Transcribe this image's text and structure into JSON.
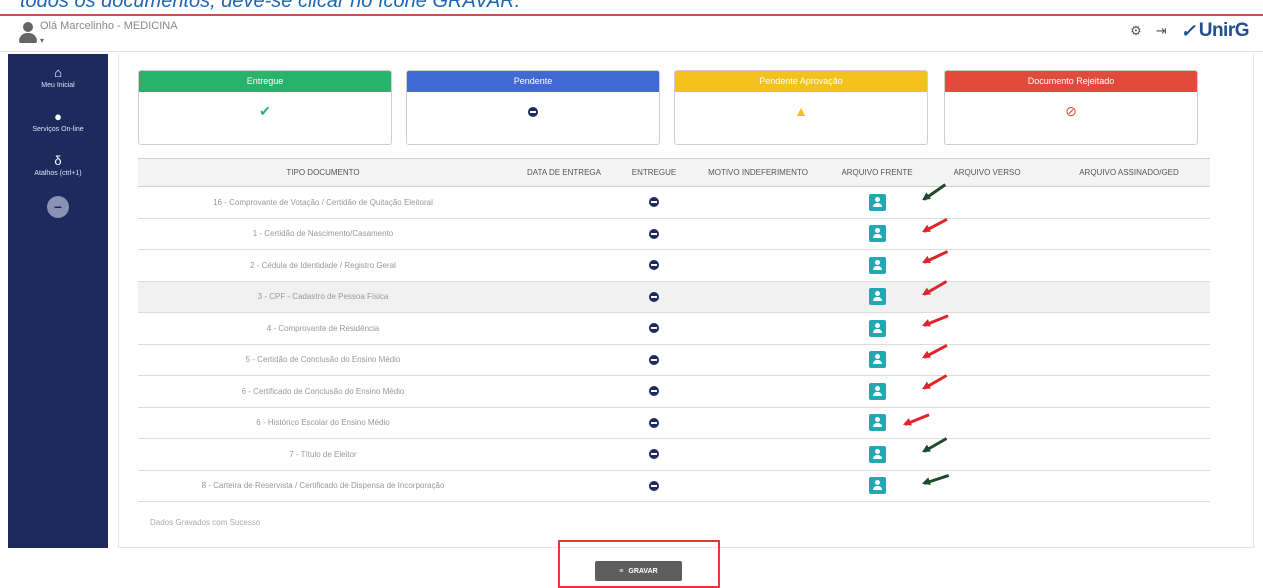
{
  "header": {
    "caption": "todos os documentos, deve-se clicar no ícone GRAVAR.",
    "greeting": "Olá Marcelinho - MEDICINA",
    "settings_icon": "settings-icon",
    "logout_icon": "logout-icon",
    "logo_text": "UnirG"
  },
  "sidebar": {
    "items": [
      {
        "label": "Meu Inicial",
        "icon": "home-icon"
      },
      {
        "label": "Serviços On-line",
        "icon": "globe-icon"
      },
      {
        "label": "Atalhos (ctrl+1)",
        "icon": "shortcut-icon"
      }
    ]
  },
  "status_cards": [
    {
      "label": "Entregue",
      "color": "#27b36b",
      "icon": "check-icon"
    },
    {
      "label": "Pendente",
      "color": "#4169d6",
      "icon": "minus-circle-icon"
    },
    {
      "label": "Pendente Aprovação",
      "color": "#f3c21f",
      "icon": "warning-icon"
    },
    {
      "label": "Documento Rejeitado",
      "color": "#e24b3b",
      "icon": "ban-icon"
    }
  ],
  "table": {
    "headers": [
      "TIPO DOCUMENTO",
      "DATA DE ENTREGA",
      "ENTREGUE",
      "MOTIVO INDEFERIMENTO",
      "ARQUIVO FRENTE",
      "ARQUIVO VERSO",
      "ARQUIVO ASSINADO/GED"
    ],
    "rows": [
      {
        "doc": "16 - Comprovante de Votação / Certidão de Quitação Eleitoral"
      },
      {
        "doc": "1 - Certidão de Nascimento/Casamento"
      },
      {
        "doc": "2 - Cédula de Identidade / Registro Geral"
      },
      {
        "doc": "3 - CPF - Cadastro de Pessoa Física"
      },
      {
        "doc": "4 - Comprovante de Residência"
      },
      {
        "doc": "5 - Certidão de Conclusão do Ensino Médio"
      },
      {
        "doc": "6 - Certificado de Conclusão do Ensino Médio"
      },
      {
        "doc": "6 - Histórico Escolar do Ensino Médio"
      },
      {
        "doc": "7 - Título de Eleitor"
      },
      {
        "doc": "8 - Carteira de Reservista / Certificado de Dispensa de Incorporação"
      }
    ]
  },
  "footer": {
    "success_message": "Dados Gravados com Sucesso",
    "save_label": "GRAVAR"
  }
}
